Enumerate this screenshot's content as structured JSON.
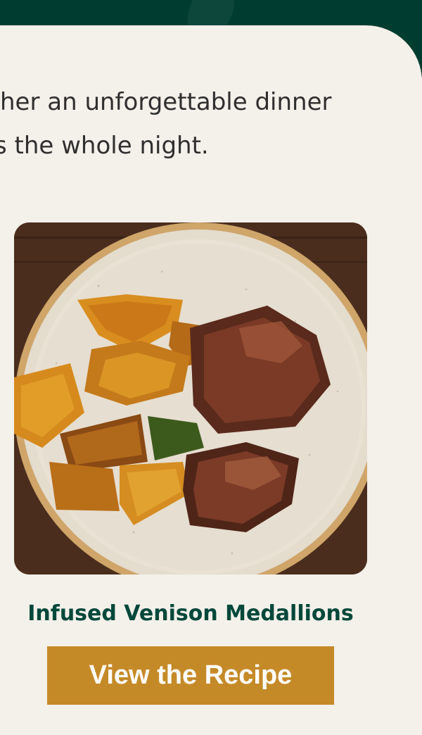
{
  "intro": {
    "line1": "her an unforgettable dinner",
    "line2": "s the whole night."
  },
  "recipe": {
    "image_subject": "plate of roasted squash and seared venison medallions",
    "title": "Infused Venison Medallions",
    "cta_label": "View the Recipe"
  },
  "colors": {
    "header_green": "#003d31",
    "background": "#f4f0ea",
    "title_green": "#00483a",
    "button_gold": "#c58a28",
    "body_text": "#2f2f2f"
  }
}
